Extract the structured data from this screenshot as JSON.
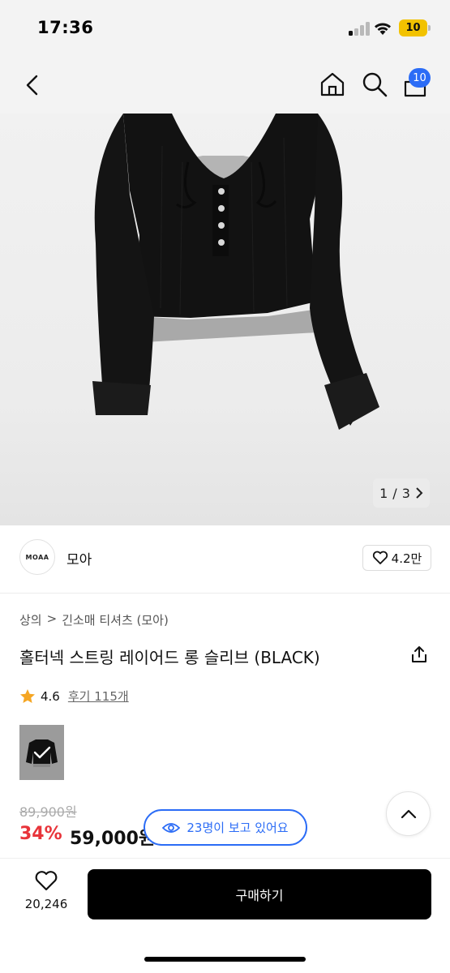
{
  "status_bar": {
    "time": "17:36",
    "battery": "10"
  },
  "nav": {
    "back_icon": "chevron-left-icon",
    "home_icon": "home-icon",
    "search_icon": "search-icon",
    "cart_icon": "cart-icon",
    "cart_count": "10"
  },
  "gallery": {
    "current": "1",
    "separator": "/",
    "total": "3"
  },
  "brand": {
    "logo_text": "MOAA",
    "name": "모아",
    "likes": "4.2만"
  },
  "breadcrumb": {
    "category": "상의",
    "separator": ">",
    "subcategory": "긴소매 티셔츠 (모아)"
  },
  "product": {
    "title": "홀터넥 스트링 레이어드 롱 슬리브 (BLACK)"
  },
  "rating": {
    "score": "4.6",
    "reviews": "후기 115개"
  },
  "price": {
    "original": "89,900원",
    "discount": "34%",
    "final": "59,000원"
  },
  "viewers": {
    "text": "23명이 보고 있어요"
  },
  "bottom": {
    "wish_count": "20,246",
    "buy_label": "구매하기"
  },
  "colors": {
    "accent": "#2b6cf6",
    "discount": "#e8343a",
    "buy_button": "#000000"
  }
}
